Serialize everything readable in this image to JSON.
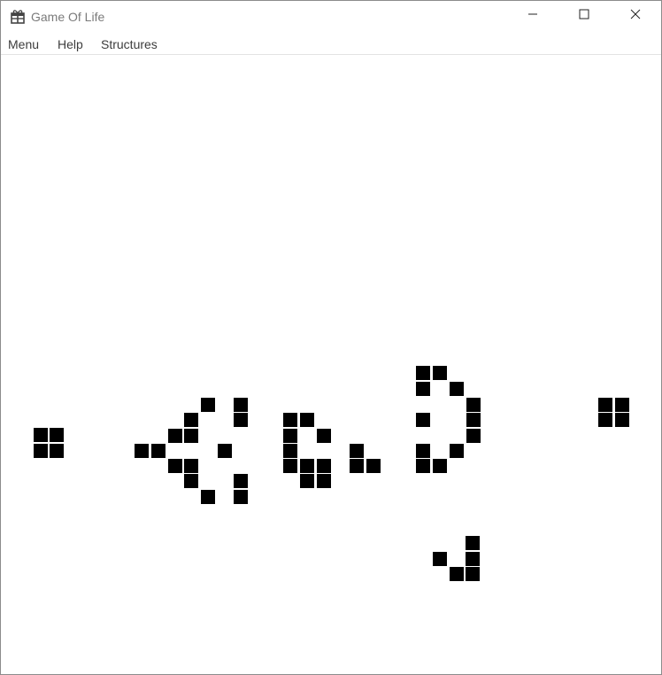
{
  "window": {
    "title": "Game Of Life",
    "icon": "gift-icon"
  },
  "controls": {
    "minimize_icon": "minimize-icon",
    "maximize_icon": "maximize-icon",
    "close_icon": "close-icon"
  },
  "menu": {
    "items": [
      "Menu",
      "Help",
      "Structures"
    ]
  },
  "board": {
    "cell_color": "#000000",
    "background_color": "#ffffff",
    "live_cells": [
      [
        38,
        483
      ],
      [
        56,
        483
      ],
      [
        38,
        501
      ],
      [
        56,
        501
      ],
      [
        227,
        449
      ],
      [
        264,
        449
      ],
      [
        208,
        466
      ],
      [
        264,
        466
      ],
      [
        190,
        484
      ],
      [
        208,
        484
      ],
      [
        152,
        501
      ],
      [
        171,
        501
      ],
      [
        246,
        501
      ],
      [
        190,
        518
      ],
      [
        208,
        518
      ],
      [
        208,
        535
      ],
      [
        264,
        535
      ],
      [
        227,
        553
      ],
      [
        264,
        553
      ],
      [
        320,
        466
      ],
      [
        339,
        466
      ],
      [
        320,
        484
      ],
      [
        358,
        484
      ],
      [
        320,
        501
      ],
      [
        320,
        518
      ],
      [
        339,
        518
      ],
      [
        358,
        518
      ],
      [
        339,
        535
      ],
      [
        358,
        535
      ],
      [
        395,
        501
      ],
      [
        395,
        518
      ],
      [
        414,
        518
      ],
      [
        470,
        413
      ],
      [
        489,
        413
      ],
      [
        470,
        431
      ],
      [
        508,
        431
      ],
      [
        527,
        449
      ],
      [
        527,
        466
      ],
      [
        470,
        466
      ],
      [
        527,
        484
      ],
      [
        470,
        501
      ],
      [
        508,
        501
      ],
      [
        470,
        518
      ],
      [
        489,
        518
      ],
      [
        676,
        449
      ],
      [
        695,
        449
      ],
      [
        676,
        466
      ],
      [
        695,
        466
      ],
      [
        526,
        605
      ],
      [
        489,
        623
      ],
      [
        526,
        623
      ],
      [
        508,
        640
      ],
      [
        526,
        640
      ]
    ]
  }
}
